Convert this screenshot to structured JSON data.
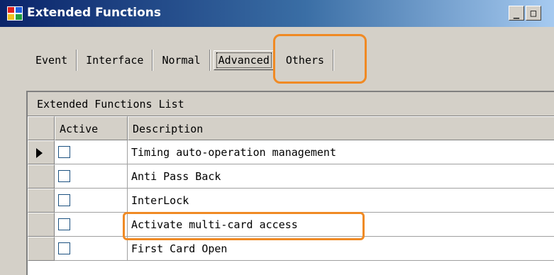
{
  "window": {
    "title": "Extended Functions",
    "icon": "app-icon",
    "min_label": "_",
    "max_label": "□"
  },
  "tabs": [
    {
      "label": "Event",
      "active": false
    },
    {
      "label": "Interface",
      "active": false
    },
    {
      "label": "Normal",
      "active": false
    },
    {
      "label": "Advanced",
      "active": true
    },
    {
      "label": "Others",
      "active": false
    }
  ],
  "grid": {
    "caption": "Extended Functions List",
    "columns": [
      "Active",
      "Description"
    ],
    "rows": [
      {
        "active": false,
        "description": "Timing auto-operation management",
        "current": true
      },
      {
        "active": false,
        "description": "Anti Pass Back",
        "current": false
      },
      {
        "active": false,
        "description": "InterLock",
        "current": false
      },
      {
        "active": false,
        "description": "Activate multi-card access",
        "current": false
      },
      {
        "active": false,
        "description": "First Card Open",
        "current": false
      }
    ]
  },
  "colors": {
    "highlight": "#f08a24",
    "titlebar_start": "#0a246a",
    "titlebar_end": "#a6caf0",
    "window_bg": "#d4d0c8"
  }
}
